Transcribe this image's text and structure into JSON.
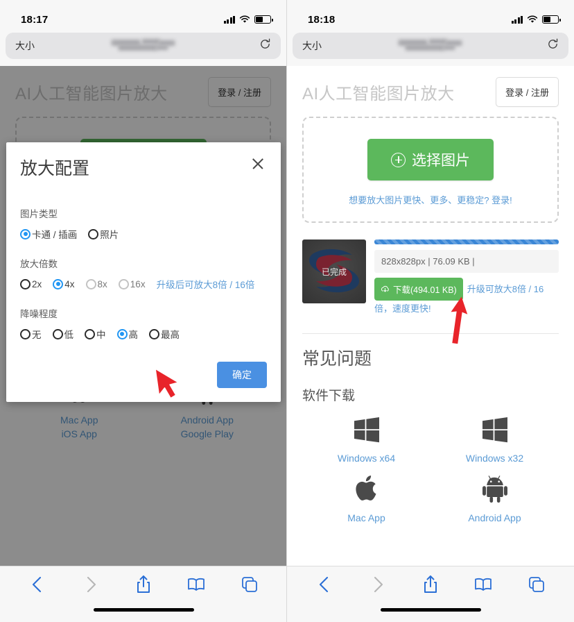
{
  "screens": [
    {
      "status": {
        "time": "18:17",
        "signal_icon": "cellular-signal-icon",
        "wifi_icon": "wifi-icon",
        "battery_icon": "battery-icon"
      },
      "urlbar": {
        "label": "大小",
        "reload_icon": "reload-icon",
        "address_redacted": true
      }
    },
    {
      "status": {
        "time": "18:18",
        "signal_icon": "cellular-signal-icon",
        "wifi_icon": "wifi-icon",
        "battery_icon": "battery-icon"
      },
      "urlbar": {
        "label": "大小",
        "reload_icon": "reload-icon",
        "address_redacted": true
      }
    }
  ],
  "app": {
    "title": "AI人工智能图片放大",
    "login_button": "登录 / 注册",
    "dropzone": {
      "choose_button": "选择图片",
      "choose_icon": "plus-circle-icon",
      "note": "想要放大图片更快、更多、更稳定? 登录!"
    },
    "file": {
      "thumb_status": "已完成",
      "progress_percent": 100,
      "meta": "828x828px | 76.09 KB |",
      "download_button": "下载(494.01 KB)",
      "download_icon": "cloud-download-icon",
      "upsell": "升级可放大8倍 / 16倍，速度更快!"
    },
    "faq_title": "常见问题",
    "software_title": "软件下载",
    "downloads": [
      {
        "icon": "windows-icon",
        "links": [
          "Windows x64"
        ]
      },
      {
        "icon": "windows-icon",
        "links": [
          "Windows x32"
        ]
      },
      {
        "icon": "apple-icon",
        "links": [
          "Mac App",
          "iOS App"
        ]
      },
      {
        "icon": "android-icon",
        "links": [
          "Android App",
          "Google Play"
        ]
      }
    ],
    "downloads_right": [
      {
        "icon": "windows-icon",
        "links": [
          "Windows x64"
        ]
      },
      {
        "icon": "windows-icon",
        "links": [
          "Windows x32"
        ]
      },
      {
        "icon": "apple-icon",
        "links": [
          "Mac App"
        ]
      },
      {
        "icon": "android-icon",
        "links": [
          "Android App"
        ]
      }
    ]
  },
  "modal": {
    "title": "放大配置",
    "close_icon": "close-icon",
    "sections": [
      {
        "label": "图片类型",
        "options": [
          {
            "text": "卡通 / 插画",
            "selected": true,
            "disabled": false
          },
          {
            "text": "照片",
            "selected": false,
            "disabled": false
          }
        ]
      },
      {
        "label": "放大倍数",
        "options": [
          {
            "text": "2x",
            "selected": false,
            "disabled": false
          },
          {
            "text": "4x",
            "selected": true,
            "disabled": false
          },
          {
            "text": "8x",
            "selected": false,
            "disabled": true
          },
          {
            "text": "16x",
            "selected": false,
            "disabled": true
          }
        ],
        "hint": "升级后可放大8倍 / 16倍"
      },
      {
        "label": "降噪程度",
        "options": [
          {
            "text": "无",
            "selected": false,
            "disabled": false
          },
          {
            "text": "低",
            "selected": false,
            "disabled": false
          },
          {
            "text": "中",
            "selected": false,
            "disabled": false
          },
          {
            "text": "高",
            "selected": true,
            "disabled": false
          },
          {
            "text": "最高",
            "selected": false,
            "disabled": false
          }
        ]
      }
    ],
    "confirm_button": "确定"
  },
  "toolbar": {
    "back_icon": "chevron-left-icon",
    "forward_icon": "chevron-right-icon",
    "share_icon": "share-icon",
    "bookmarks_icon": "book-icon",
    "tabs_icon": "tabs-icon"
  },
  "colors": {
    "accent_blue": "#2196f3",
    "link_blue": "#5b9bd5",
    "green": "#5cb85c",
    "confirm_blue": "#4a90e2",
    "cursor_red": "#e8242a"
  }
}
